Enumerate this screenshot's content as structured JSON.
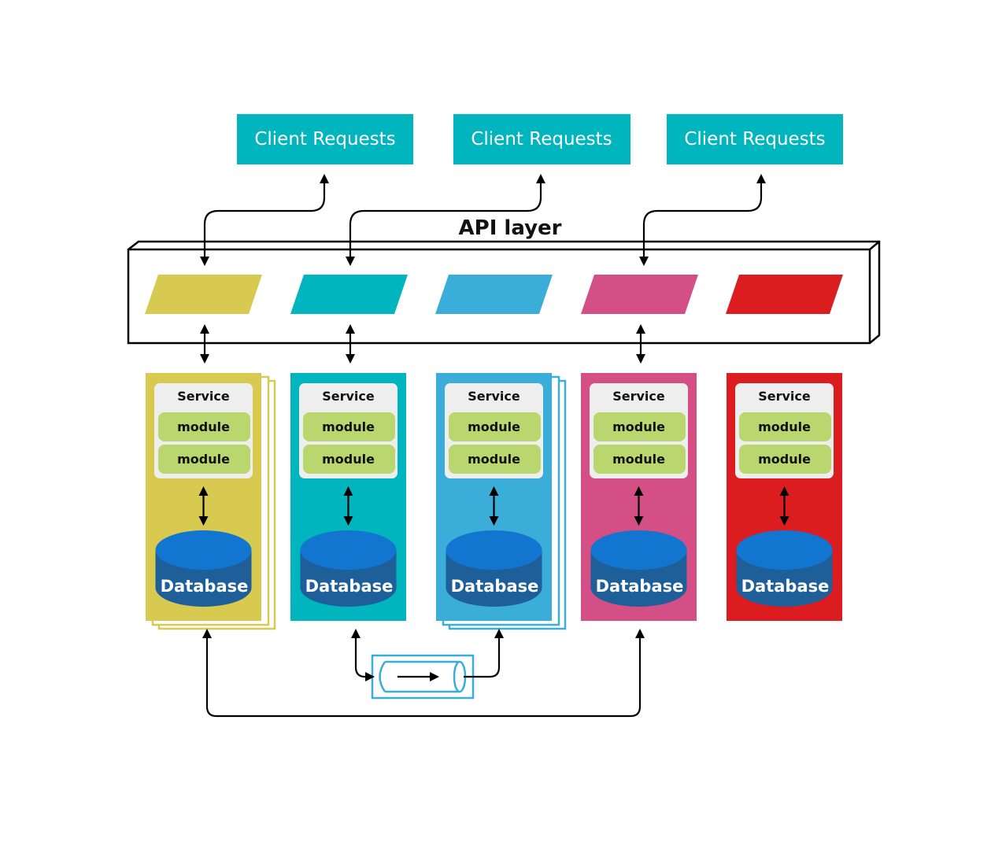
{
  "title": "API layer",
  "colors": {
    "client": "#00b5bd",
    "service_panel": "#eeeeee",
    "module": "#bad66e",
    "db_top": "#1275d0",
    "db_body": "#1e5f9a",
    "queue": "#3aaed8"
  },
  "clients": [
    {
      "label": "Client Requests"
    },
    {
      "label": "Client Requests"
    },
    {
      "label": "Client Requests"
    }
  ],
  "services": [
    {
      "color": "#d8c951",
      "stacked": true,
      "service_label": "Service",
      "modules": [
        "module",
        "module"
      ],
      "db_label": "Database"
    },
    {
      "color": "#00b5bd",
      "stacked": false,
      "service_label": "Service",
      "modules": [
        "module",
        "module"
      ],
      "db_label": "Database"
    },
    {
      "color": "#3aaed8",
      "stacked": true,
      "service_label": "Service",
      "modules": [
        "module",
        "module"
      ],
      "db_label": "Database"
    },
    {
      "color": "#d44f85",
      "stacked": false,
      "service_label": "Service",
      "modules": [
        "module",
        "module"
      ],
      "db_label": "Database"
    },
    {
      "color": "#dc1d20",
      "stacked": false,
      "service_label": "Service",
      "modules": [
        "module",
        "module"
      ],
      "db_label": "Database"
    }
  ],
  "connections": {
    "client_to_api": [
      [
        0,
        0
      ],
      [
        1,
        1
      ],
      [
        2,
        3
      ]
    ],
    "api_to_service": [
      0,
      1,
      3
    ],
    "queue": {
      "from": 1,
      "to": 2
    },
    "bottom_link": {
      "from": 0,
      "to": 3
    }
  }
}
